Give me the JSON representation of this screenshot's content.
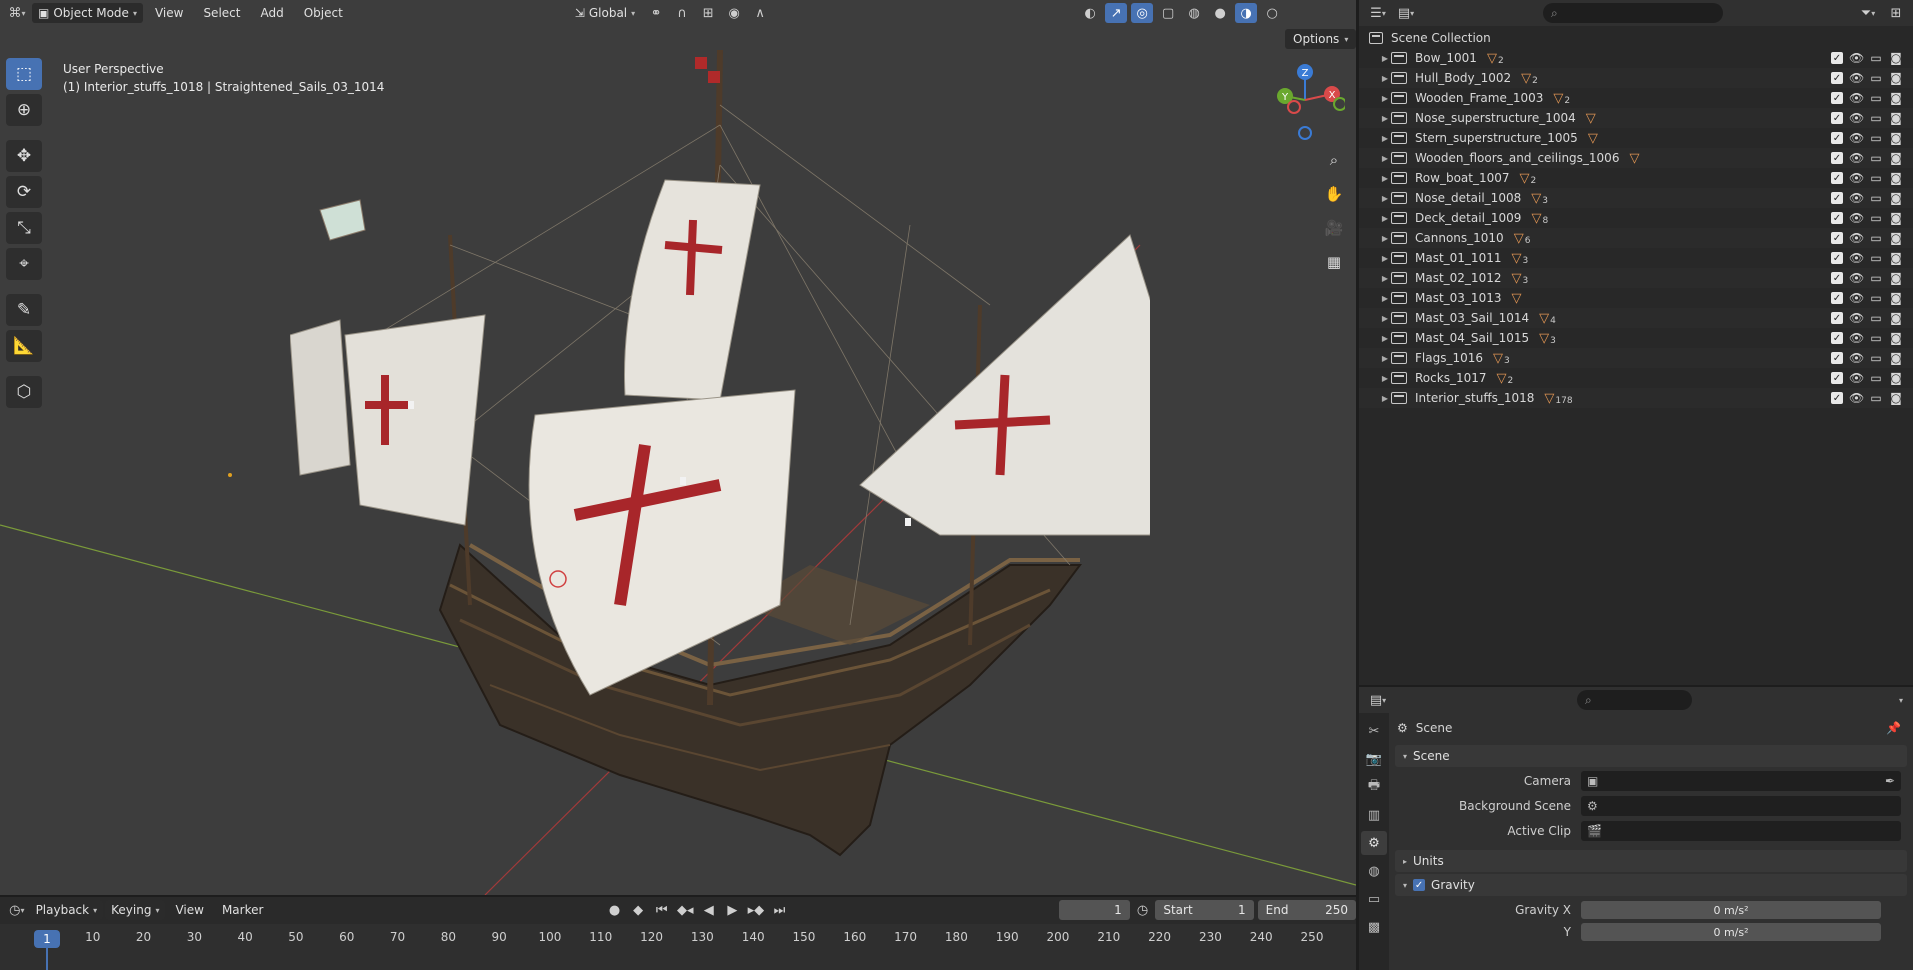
{
  "viewport": {
    "header": {
      "mode": "Object Mode",
      "menus": [
        "View",
        "Select",
        "Add",
        "Object"
      ],
      "transform_orientation": "Global",
      "options": "Options"
    },
    "info": {
      "perspective": "User Perspective",
      "selection": "(1) Interior_stuffs_1018 | Straightened_Sails_03_1014"
    },
    "gizmo": {
      "x": "X",
      "y": "Y",
      "z": "Z"
    }
  },
  "timeline": {
    "menus": [
      "Playback",
      "Keying",
      "View",
      "Marker"
    ],
    "current_frame": "1",
    "start_label": "Start",
    "start_value": "1",
    "end_label": "End",
    "end_value": "250",
    "ruler": [
      "1",
      "10",
      "20",
      "30",
      "40",
      "50",
      "60",
      "70",
      "80",
      "90",
      "100",
      "110",
      "120",
      "130",
      "140",
      "150",
      "160",
      "170",
      "180",
      "190",
      "200",
      "210",
      "220",
      "230",
      "240",
      "250"
    ]
  },
  "outliner": {
    "root": "Scene Collection",
    "items": [
      {
        "name": "Bow_1001",
        "count": "2"
      },
      {
        "name": "Hull_Body_1002",
        "count": "2"
      },
      {
        "name": "Wooden_Frame_1003",
        "count": "2"
      },
      {
        "name": "Nose_superstructure_1004",
        "count": ""
      },
      {
        "name": "Stern_superstructure_1005",
        "count": ""
      },
      {
        "name": "Wooden_floors_and_ceilings_1006",
        "count": ""
      },
      {
        "name": "Row_boat_1007",
        "count": "2"
      },
      {
        "name": "Nose_detail_1008",
        "count": "3"
      },
      {
        "name": "Deck_detail_1009",
        "count": "8"
      },
      {
        "name": "Cannons_1010",
        "count": "6"
      },
      {
        "name": "Mast_01_1011",
        "count": "3"
      },
      {
        "name": "Mast_02_1012",
        "count": "3"
      },
      {
        "name": "Mast_03_1013",
        "count": ""
      },
      {
        "name": "Mast_03_Sail_1014",
        "count": "4"
      },
      {
        "name": "Mast_04_Sail_1015",
        "count": "3"
      },
      {
        "name": "Flags_1016",
        "count": "3"
      },
      {
        "name": "Rocks_1017",
        "count": "2"
      },
      {
        "name": "Interior_stuffs_1018",
        "count": "178"
      }
    ]
  },
  "properties": {
    "title": "Scene",
    "panel_scene": "Scene",
    "camera_label": "Camera",
    "background_label": "Background Scene",
    "clip_label": "Active Clip",
    "units_label": "Units",
    "gravity_label": "Gravity",
    "gravity_x_label": "Gravity X",
    "gravity_x": "0 m/s²",
    "gravity_y_label": "Y",
    "gravity_y": "0 m/s²"
  }
}
